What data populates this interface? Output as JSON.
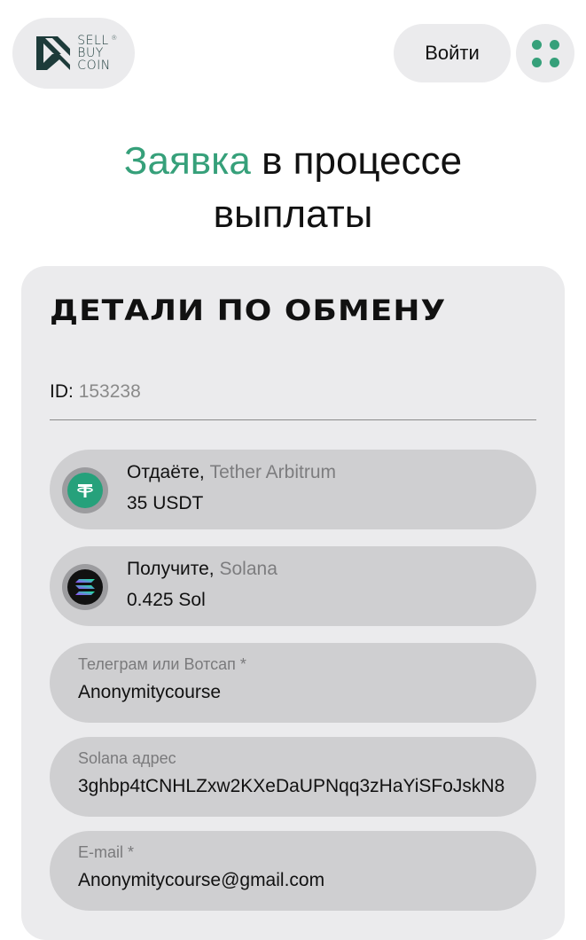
{
  "header": {
    "logo": {
      "line1": "SELL",
      "line2": "BUY",
      "line3": "COIN",
      "mark": "®"
    },
    "login_label": "Войти",
    "menu_icon": "grid-dots-icon"
  },
  "title": {
    "accent": "Заявка",
    "rest_line1": " в процессе",
    "line2": "выплаты"
  },
  "card": {
    "heading": "ДЕТАЛИ ПО ОБМЕНУ",
    "id_label": "ID:",
    "id_value": "153238",
    "give": {
      "label": "Отдаёте,",
      "network": "Tether Arbitrum",
      "amount": "35 USDT",
      "icon": "tether-icon"
    },
    "receive": {
      "label": "Получите,",
      "network": "Solana",
      "amount": "0.425 Sol",
      "icon": "solana-icon"
    },
    "fields": [
      {
        "label": "Телеграм или Вотсап *",
        "value": "Anonymitycourse"
      },
      {
        "label": "Solana адрес",
        "value": "3ghbp4tCNHLZxw2KXeDaUPNqq3zHaYiSFoJskN8"
      },
      {
        "label": "E-mail *",
        "value": "Anonymitycourse@gmail.com"
      }
    ]
  },
  "colors": {
    "accent": "#36a07a",
    "pill": "#cfcfd1",
    "card": "#ebebed"
  }
}
